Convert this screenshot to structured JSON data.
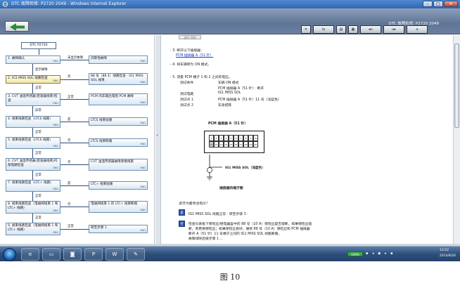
{
  "window": {
    "title": "DTC 故障检修: P2720 2049 - Windows Internet Explorer",
    "minimize": "–",
    "maximize": "□",
    "close": "✕"
  },
  "header": {
    "title": "DTC 故障检修: P2720 2049",
    "back_label": "⇦"
  },
  "toolbar": {
    "icons": [
      "close-icon",
      "forward-icon",
      "book-icon",
      "print-icon",
      "back-icon",
      "doc-icon",
      "arrow-icon",
      "tool-icon"
    ]
  },
  "flow": {
    "title": "DTC P2720",
    "steps": [
      {
        "label": "1.   故障确认",
        "en": "ENG"
      },
      {
        "label": "2.   IG1 MISS SOL 线路检查",
        "en": "ENG"
      },
      {
        "label": "3.   CVT 油温传感器(变速器线束)检查",
        "en": "ENG"
      },
      {
        "label": "4.   线束线路检查（LTCS 线路）",
        "en": "ENG"
      },
      {
        "label": "5.   线束线路检查（LTCS 线路）",
        "en": "ENG"
      },
      {
        "label": "6.   CVT 油温传感器(变速器线束)内部电路检查",
        "en": "ENG"
      },
      {
        "label": "7.   线束线路检查（LTC+ 线路）",
        "en": "ENG"
      },
      {
        "label": "8.   线束线路检查（电磁阀线束 1 和 LTC+ 线路）",
        "en": "ENG"
      },
      {
        "label": "9.   线束线路检查（电磁阀线束 1 和 LTC+ 线路）",
        "en": "ENG"
      }
    ],
    "results": [
      {
        "label": "间歇性故障",
        "en": "ENG"
      },
      {
        "label": "88 号（88 4）线路检查 - IG1 MISS SOL 线束",
        "en": "ENG"
      },
      {
        "label": "PCM 的非输出电阻 PCM 故障",
        "en": "ENG"
      },
      {
        "label": "LTCS 线束短路",
        "en": "ENG"
      },
      {
        "label": "LTCS 线束断路",
        "en": "ENG"
      },
      {
        "label": "CVT 油温传感器故障更换线束",
        "en": "ENG"
      },
      {
        "label": "LTC+ 线束短路",
        "en": "ENG"
      },
      {
        "label": "电磁阀线束 1 的 LTC+ 线束断路",
        "en": "ENG"
      },
      {
        "label": "转至步骤 1",
        "en": "ENG"
      }
    ],
    "labels": {
      "not_detected": "未显示故障",
      "detected": "显示故障",
      "normal": "正常",
      "abnormal": "异常",
      "no": "否",
      "yes": "是"
    }
  },
  "content": {
    "top_button": "返回 顶部",
    "step3": "- 3. 断开以下插接器：",
    "step3_link": "PCM 插接器 A（51 针）",
    "step4": "- 4. 将车辆转为 ON 模式。",
    "step5": "- 5. 测量 PCM 端子 1 和 2 之间的电压。",
    "rows": [
      {
        "k": "测试条件",
        "v": "车辆 ON 模式"
      },
      {
        "k": "",
        "v": "PCM 插接器 A（51 针）：断开"
      },
      {
        "k": "测试电路",
        "v": "IG1 MISS SOL"
      },
      {
        "k": "测试点 1",
        "v": "PCM 插接器 A（51 针）11 号（浅蓝色）"
      },
      {
        "k": "测试点 2",
        "v": "车身搭铁"
      }
    ],
    "connector_title": "PCM 插接器 A（51 针）",
    "connector_upper": [
      "1",
      "2",
      "3",
      "4",
      "5",
      "6",
      "7",
      "8",
      "9",
      "10"
    ],
    "connector_lower": [
      "11",
      "12",
      "13",
      "14",
      "15",
      "16",
      "17",
      "18",
      "19",
      "20"
    ],
    "wire_label": "IG1 MISS SOL（浅蓝色）",
    "connector_caption": "插接器的端子侧",
    "question": "是否为蓄电池电压？",
    "answer_yes": "IG1 MISS SOL 线路正常 - 转至步骤 3 -",
    "answer_no_1": "检查仪表板下保险丝/继电器盒中的 88 号（10 A）保险丝是否熔断，如果保险丝熔",
    "answer_no_2": "断，则更换保险丝；如果保险丝良好，维修 88 号（10 A）保险丝和 PCM 插接器",
    "answer_no_3": "断开 A（51 针）11 号端子之间的 IG1 MISS SOL 线路断路。",
    "answer_no_4": "故障排除后按步骤 1 ...",
    "badge_yes": "是",
    "badge_no": "否"
  },
  "taskbar": {
    "apps": [
      "ie-icon",
      "folder-icon",
      "office-icon",
      "ppt-icon",
      "word-icon",
      "paint-icon"
    ],
    "battery": "100%",
    "time": "13:52",
    "date": "2014/8/26"
  },
  "caption": "图 10"
}
